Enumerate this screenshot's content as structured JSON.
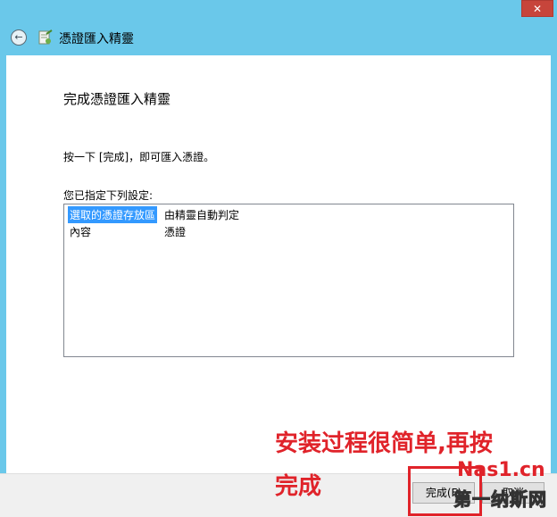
{
  "window": {
    "title": "憑證匯入精靈",
    "close_label": "✕",
    "back_label": "←"
  },
  "page": {
    "heading": "完成憑證匯入精靈",
    "instruction": "按一下 [完成]，即可匯入憑證。",
    "list_label": "您已指定下列設定:",
    "settings": [
      {
        "key": "選取的憑證存放區",
        "value": "由精靈自動判定"
      },
      {
        "key": "內容",
        "value": "憑證"
      }
    ]
  },
  "buttons": {
    "finish_label": "完成(F)",
    "cancel_label": "取消"
  },
  "annotation": {
    "line1": "安装过程很简单,再按",
    "line2": "完成"
  },
  "watermark": {
    "top": "Nas1.cn",
    "bottom": "第一纳斯网"
  },
  "colors": {
    "frame": "#6ac8ea",
    "annotation": "#e0232a",
    "selection": "#3399ff"
  }
}
